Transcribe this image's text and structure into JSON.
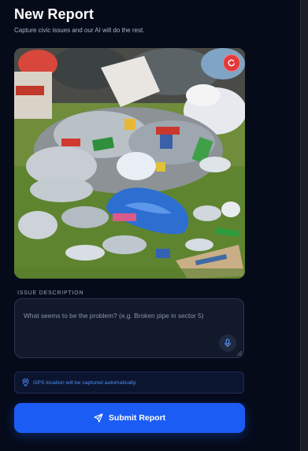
{
  "header": {
    "title": "New Report",
    "subtitle": "Capture civic issues and our AI will do the rest."
  },
  "photo": {
    "remove_icon": "close-circle-icon"
  },
  "description": {
    "label": "ISSUE DESCRIPTION",
    "placeholder": "What seems to be the problem? (e.g. Broken pipe in sector 5)",
    "value": "",
    "mic_icon": "microphone-icon"
  },
  "gps": {
    "icon": "location-pin-icon",
    "text": "GPS location will be captured automatically."
  },
  "submit": {
    "label": "Submit Report",
    "icon": "send-icon"
  },
  "colors": {
    "background": "#060b1a",
    "accent": "#1b5cf5",
    "danger": "#e23a3a",
    "gps_text": "#4d8ff5"
  }
}
